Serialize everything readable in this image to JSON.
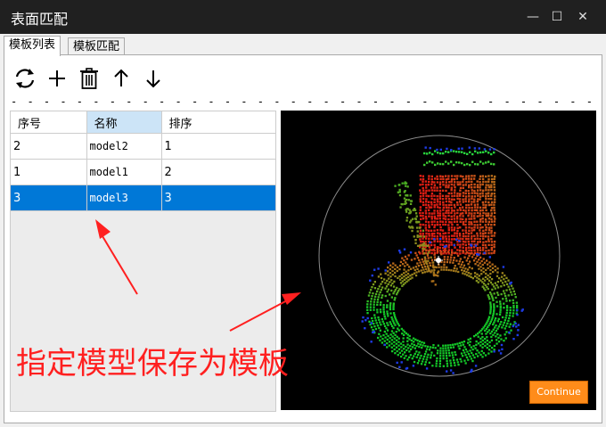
{
  "window": {
    "title": "表面匹配",
    "minimize_glyph": "—",
    "maximize_glyph": "☐",
    "close_glyph": "✕"
  },
  "tabs": [
    {
      "label": "模板列表",
      "active": true
    },
    {
      "label": "模板匹配",
      "active": false
    }
  ],
  "toolbar": {
    "icons": [
      "refresh-icon",
      "add-icon",
      "delete-icon",
      "arrow-up-icon",
      "arrow-down-icon"
    ],
    "separator": "- - - - - - - - - - - - - - - - - - - - - - - - - - - - - - - - - - - - - - - - - - - - - - - - - - - - - - - - - - - - - - - -"
  },
  "table": {
    "columns": [
      "序号",
      "名称",
      "排序"
    ],
    "rows": [
      [
        "2",
        "model2",
        "1"
      ],
      [
        "1",
        "model1",
        "2"
      ],
      [
        "3",
        "model3",
        "3"
      ]
    ],
    "selected_row": 2
  },
  "viewer": {
    "continue_label": "Continue",
    "background": "#000000"
  },
  "annotation": {
    "text": "指定模型保存为模板",
    "color": "#ff2020"
  },
  "colors": {
    "accent": "#0078d7",
    "header_highlight": "#cce4f7",
    "continue_button": "#ff8c1a",
    "titlebar": "#202020"
  }
}
